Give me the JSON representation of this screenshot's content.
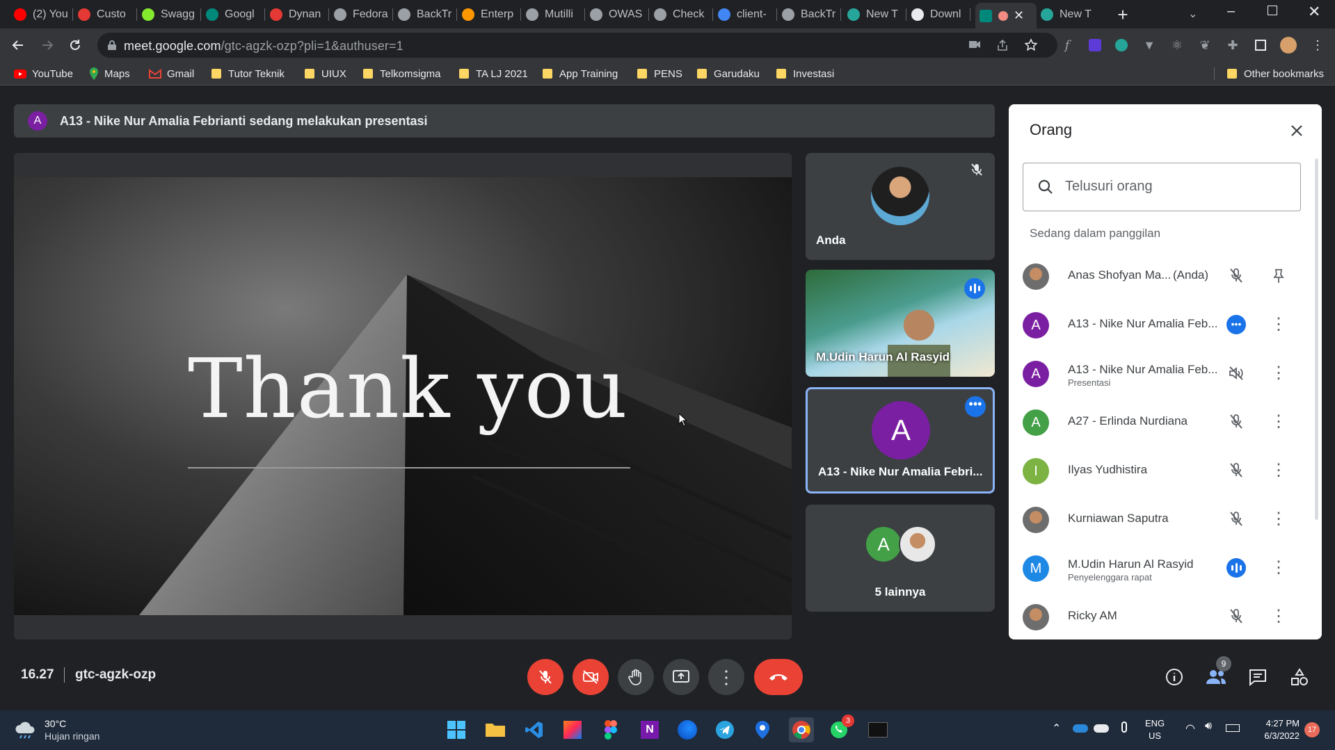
{
  "browser": {
    "tabs": [
      {
        "label": "(2) You",
        "icon": "youtube-icon",
        "color": "#ff0000"
      },
      {
        "label": "Custo",
        "icon": "shield-icon",
        "color": "#e53935"
      },
      {
        "label": "Swagg",
        "icon": "swagger-icon",
        "color": "#85ea2d"
      },
      {
        "label": "Googl",
        "icon": "meet-icon",
        "color": "#00897b"
      },
      {
        "label": "Dynan",
        "icon": "shield-icon",
        "color": "#e53935"
      },
      {
        "label": "Fedora",
        "icon": "globe-icon",
        "color": "#9aa0a6"
      },
      {
        "label": "BackTr",
        "icon": "globe-icon",
        "color": "#9aa0a6"
      },
      {
        "label": "Enterp",
        "icon": "e-icon",
        "color": "#ff9800"
      },
      {
        "label": "Mutilli",
        "icon": "globe-icon",
        "color": "#9aa0a6"
      },
      {
        "label": "OWAS",
        "icon": "globe-icon",
        "color": "#9aa0a6"
      },
      {
        "label": "Check",
        "icon": "cube-icon",
        "color": "#9aa0a6"
      },
      {
        "label": "client-",
        "icon": "google-icon",
        "color": "#4285f4"
      },
      {
        "label": "BackTr",
        "icon": "globe-icon",
        "color": "#9aa0a6"
      },
      {
        "label": "New T",
        "icon": "m-icon",
        "color": "#26a69a"
      },
      {
        "label": "Downl",
        "icon": "download-icon",
        "color": "#e8eaed"
      },
      {
        "label": "",
        "icon": "meet-icon",
        "color": "#00897b"
      },
      {
        "label": "New T",
        "icon": "m-icon",
        "color": "#26a69a"
      }
    ],
    "url_host": "meet.google.com",
    "url_path": "/gtc-agzk-ozp?pli=1&authuser=1",
    "bookmarks": [
      "YouTube",
      "Maps",
      "Gmail",
      "Tutor Teknik",
      "UIUX",
      "Telkomsigma",
      "TA LJ 2021",
      "App Training",
      "PENS",
      "Garudaku",
      "Investasi"
    ],
    "other_bookmarks": "Other bookmarks"
  },
  "meet": {
    "presenting_banner": "A13 - Nike Nur Amalia Febrianti sedang melakukan presentasi",
    "banner_avatar_letter": "A",
    "slide_text": "Thank you",
    "tiles": [
      {
        "name": "Anda"
      },
      {
        "name": "M.Udin Harun Al Rasyid"
      },
      {
        "name": "A13 - Nike Nur Amalia Febri...",
        "avatar_letter": "A"
      },
      {
        "name": "5 lainnya",
        "avatar_letter": "A"
      }
    ],
    "panel": {
      "title": "Orang",
      "search_placeholder": "Telusuri orang",
      "section_label": "Sedang dalam panggilan",
      "people": [
        {
          "name": "Anas Shofyan Ma...",
          "tag": "(Anda)",
          "avatar": "photo",
          "status": "mic-off"
        },
        {
          "name": "A13 - Nike Nur Amalia Feb...",
          "letter": "A",
          "color": "#7b1fa2",
          "status": "speaking-dots"
        },
        {
          "name": "A13 - Nike Nur Amalia Feb...",
          "sub": "Presentasi",
          "letter": "A",
          "color": "#7b1fa2",
          "status": "volume-off"
        },
        {
          "name": "A27 - Erlinda Nurdiana",
          "letter": "A",
          "color": "#43a047",
          "status": "mic-off"
        },
        {
          "name": "Ilyas Yudhistira",
          "letter": "I",
          "color": "#7cb342",
          "status": "mic-off"
        },
        {
          "name": "Kurniawan Saputra",
          "avatar": "photo",
          "status": "mic-off"
        },
        {
          "name": "M.Udin Harun Al Rasyid",
          "sub": "Penyelenggara rapat",
          "letter": "M",
          "color": "#1e88e5",
          "status": "speaking"
        },
        {
          "name": "Ricky AM",
          "avatar": "photo",
          "status": "mic-off"
        }
      ]
    },
    "bottom": {
      "time": "16.27",
      "meeting_code": "gtc-agzk-ozp",
      "people_count": "9"
    }
  },
  "taskbar": {
    "weather_temp": "30°C",
    "weather_desc": "Hujan ringan",
    "lang1": "ENG",
    "lang2": "US",
    "clock_time": "4:27 PM",
    "clock_date": "6/3/2022",
    "notif_count": "17",
    "whatsapp_badge": "3"
  }
}
